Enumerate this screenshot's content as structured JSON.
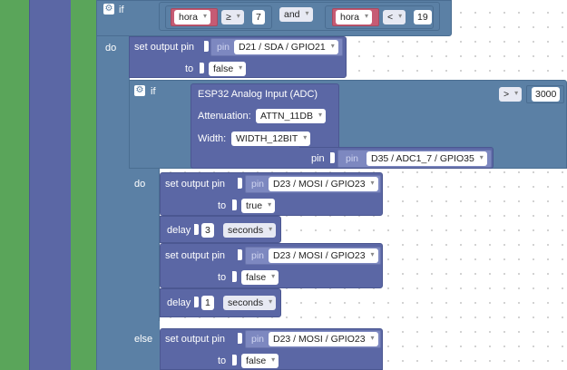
{
  "if_main": {
    "keyword": "if",
    "do": "do"
  },
  "cond_main": {
    "left_var": "hora",
    "left_op": "≥",
    "left_value": "7",
    "joiner": "and",
    "right_var": "hora",
    "right_op": "<",
    "right_value": "19"
  },
  "set_pin_1": {
    "label": "set output pin",
    "pin_label": "pin",
    "pin": "D21 / SDA / GPIO21",
    "to_label": "to",
    "value": "false"
  },
  "if_inner": {
    "keyword": "if",
    "do": "do",
    "else": "else",
    "compare_op": ">",
    "compare_value": "3000"
  },
  "adc": {
    "title": "ESP32 Analog Input (ADC)",
    "attenuation_label": "Attenuation:",
    "attenuation": "ATTN_11DB",
    "width_label": "Width:",
    "width": "WIDTH_12BIT",
    "pin_label": "pin",
    "pin_inner_label": "pin",
    "pin": "D35 / ADC1_7 / GPIO35"
  },
  "do_blocks": {
    "set1": {
      "label": "set output pin",
      "pin_label": "pin",
      "pin": "D23 / MOSI / GPIO23",
      "to_label": "to",
      "value": "true"
    },
    "delay1": {
      "label": "delay",
      "amount": "3",
      "unit": "seconds"
    },
    "set2": {
      "label": "set output pin",
      "pin_label": "pin",
      "pin": "D23 / MOSI / GPIO23",
      "to_label": "to",
      "value": "false"
    },
    "delay2": {
      "label": "delay",
      "amount": "1",
      "unit": "seconds"
    }
  },
  "else_blocks": {
    "set1": {
      "label": "set output pin",
      "pin_label": "pin",
      "pin": "D23 / MOSI / GPIO23",
      "to_label": "to",
      "value": "false"
    }
  },
  "colors": {
    "sidebar_green": "#5aa55a",
    "sidebar_blue": "#5b67a5",
    "logic_block": "#5b80a5",
    "io_block": "#5b67a5",
    "variable_block": "#c65b74"
  }
}
